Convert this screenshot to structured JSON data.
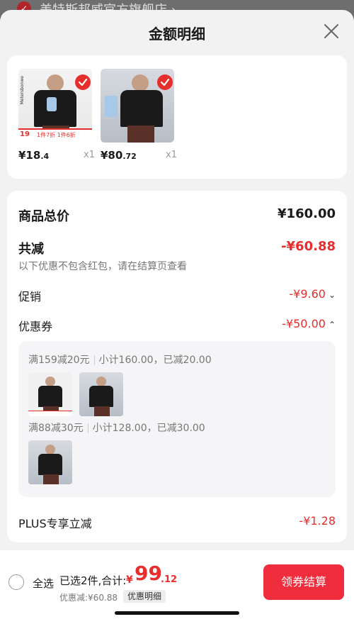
{
  "background": {
    "store_name": "美特斯邦威官方旗舰店 ›"
  },
  "sheet": {
    "title": "金额明细"
  },
  "products": [
    {
      "price": "¥18",
      "price_decimal": ".4",
      "qty": "x1",
      "promo_num": "19",
      "promo_text": "1件7折 1件6折"
    },
    {
      "price": "¥80",
      "price_decimal": ".72",
      "qty": "x1"
    }
  ],
  "breakdown": {
    "total_label": "商品总价",
    "total_value": "¥160.00",
    "reduce_label": "共减",
    "reduce_value": "-¥60.88",
    "reduce_note": "以下优惠不包含红包，请在结算页查看",
    "promo_label": "促销",
    "promo_value": "-¥9.60",
    "coupon_label": "优惠券",
    "coupon_value": "-¥50.00",
    "plus_label": "PLUS专享立减",
    "plus_value": "-¥1.28"
  },
  "coupons": [
    {
      "rule": "满159减20元",
      "summary": "小计160.00，已减20.00"
    },
    {
      "rule": "满88减30元",
      "summary": "小计128.00，已减30.00"
    }
  ],
  "bottom": {
    "select_all": "全选",
    "selected_text": "已选2件,合计:",
    "currency": "¥",
    "total_int": "99",
    "total_dec": ".12",
    "discount_text": "优惠减:¥60.88",
    "detail_tag": "优惠明细",
    "checkout": "领券结算"
  },
  "colors": {
    "accent_red": "#e82d2d",
    "button_red": "#f02d3c"
  }
}
